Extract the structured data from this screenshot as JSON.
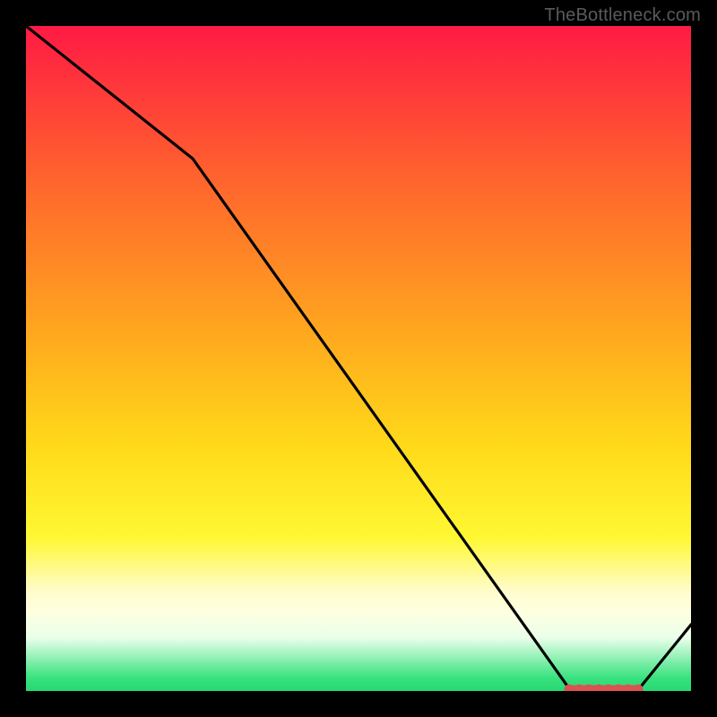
{
  "attribution": "TheBottleneck.com",
  "chart_data": {
    "type": "line",
    "title": "",
    "xlabel": "",
    "ylabel": "",
    "xlim": [
      0,
      100
    ],
    "ylim": [
      0,
      100
    ],
    "series": [
      {
        "name": "curve",
        "x": [
          0,
          25,
          82,
          92,
          100
        ],
        "y": [
          100,
          80,
          0,
          0,
          10
        ]
      }
    ],
    "markers": {
      "name": "highlight-band",
      "x": [
        82,
        83.5,
        85,
        86.5,
        88,
        89.5,
        91,
        92
      ],
      "y": [
        0,
        0,
        0,
        0,
        0,
        0,
        0,
        0
      ]
    }
  },
  "colors": {
    "curve": "#000000",
    "marker": "#d9534f"
  }
}
